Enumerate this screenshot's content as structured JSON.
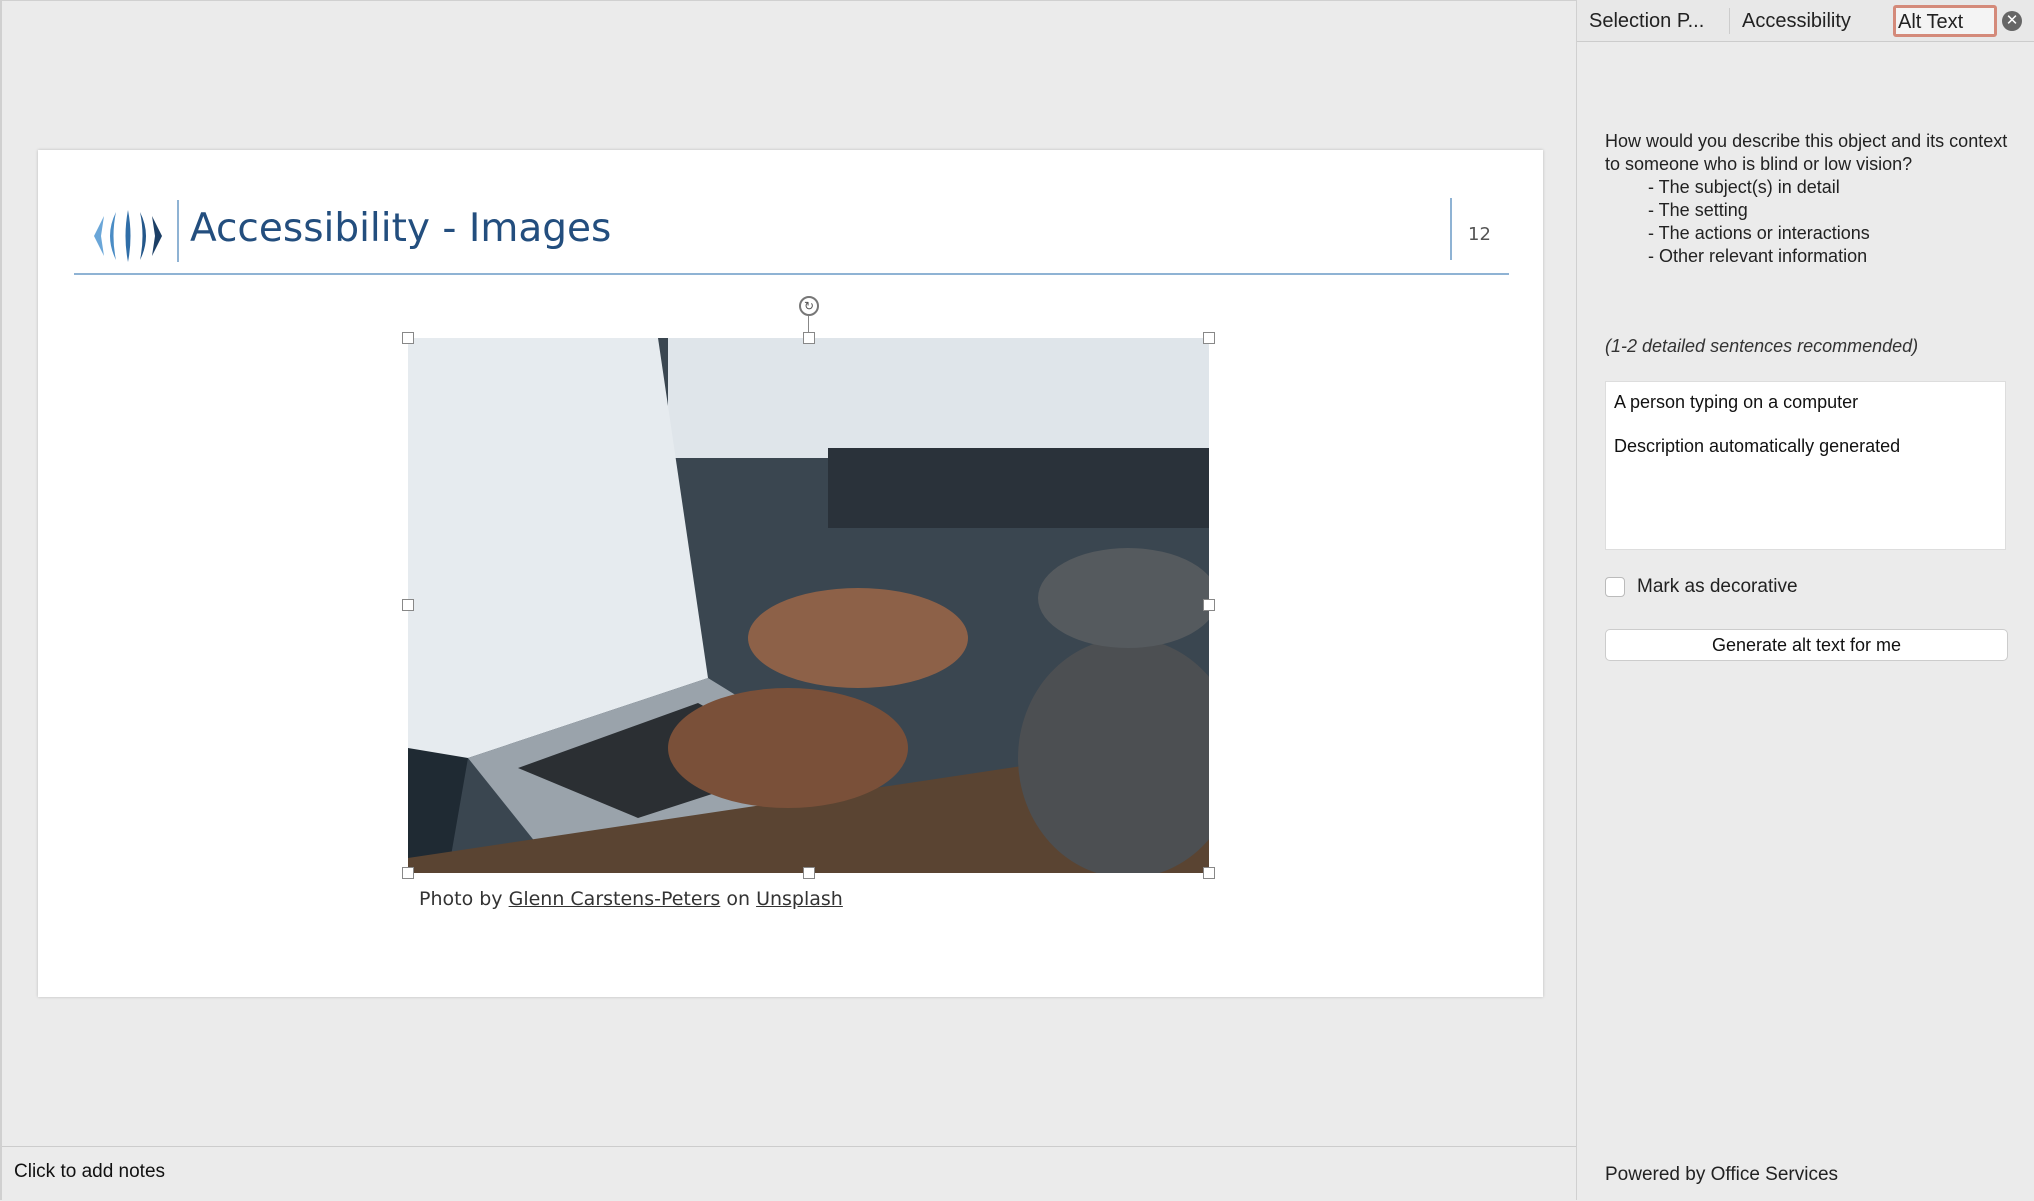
{
  "slide": {
    "title": "Accessibility - Images",
    "page_number": "12",
    "caption": {
      "prefix": "Photo by",
      "author": "Glenn Carstens-Peters",
      "mid": "on",
      "site": "Unsplash"
    }
  },
  "notes": {
    "placeholder": "Click to add notes"
  },
  "panel": {
    "tabs": [
      "Selection P...",
      "Accessibility",
      "Alt Text"
    ],
    "active_tab": "Alt Text",
    "question": "How would you describe this object and its context to someone who is blind or low vision?",
    "bullets": [
      "- The subject(s) in detail",
      "- The setting",
      "- The actions or interactions",
      "- Other relevant information"
    ],
    "recommendation": "(1-2 detailed sentences recommended)",
    "alt_text": "A person typing on a computer\n\nDescription automatically generated",
    "decorative_label": "Mark as decorative",
    "decorative_checked": false,
    "generate_button": "Generate alt text for me",
    "footer": "Powered by Office Services"
  },
  "colors": {
    "title": "#234e7e",
    "accent_line": "#8fb3d4",
    "active_tab_border": "#d48a7a"
  }
}
